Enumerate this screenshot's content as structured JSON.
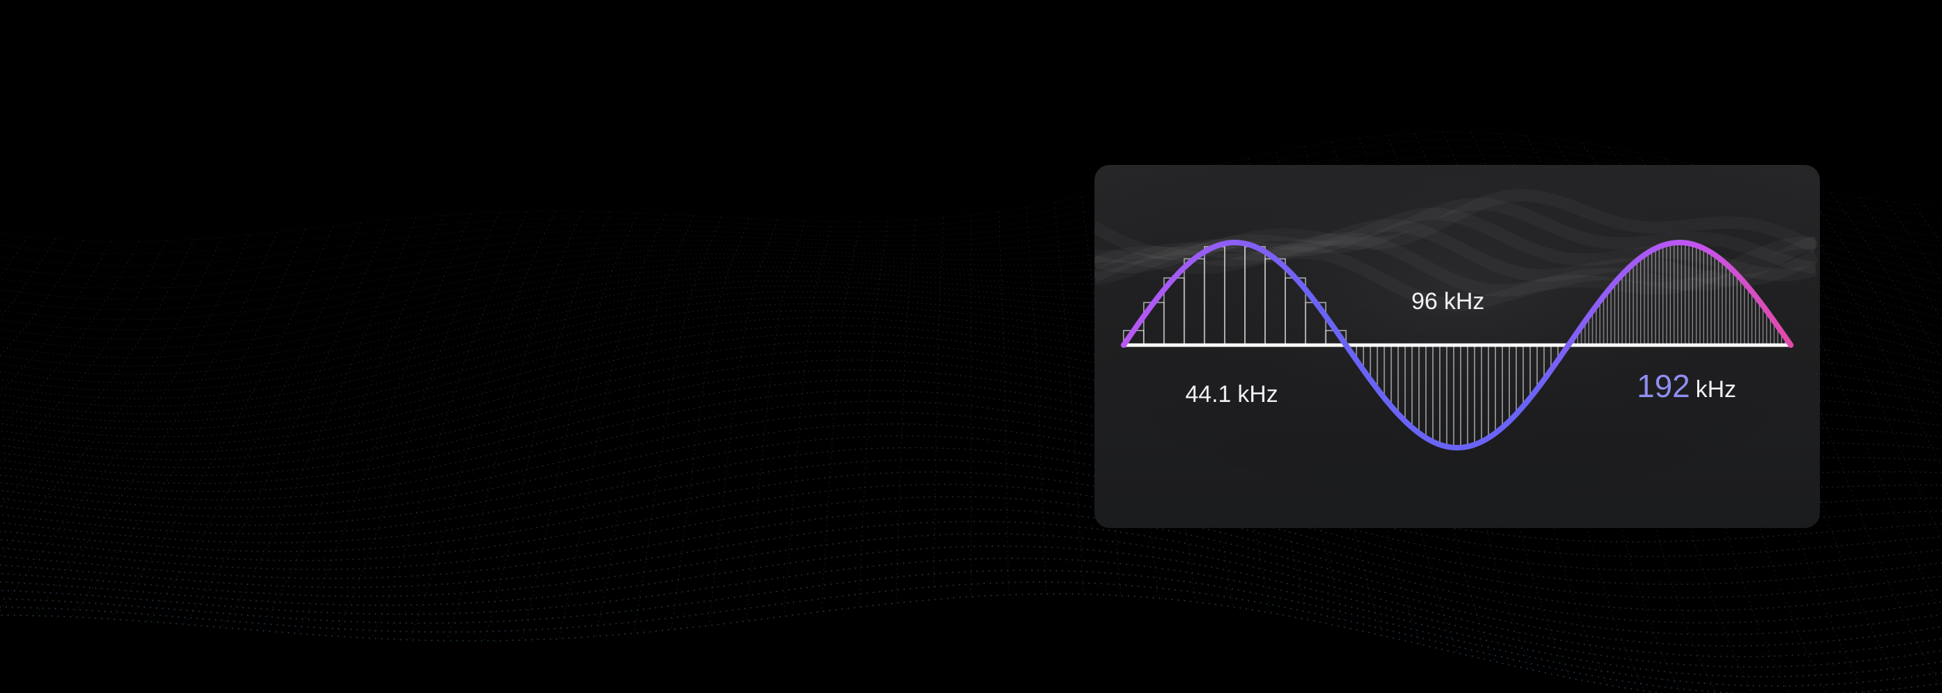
{
  "labels": {
    "low": {
      "value": "44.1",
      "unit": "kHz"
    },
    "mid": {
      "value": "96",
      "unit": "kHz"
    },
    "high": {
      "value": "192",
      "unit": "kHz"
    }
  },
  "colors": {
    "wave_gradient_start": "#c056f2",
    "wave_gradient_mid": "#6a64f6",
    "wave_gradient_end": "#e8489c",
    "baseline": "#ffffff",
    "highlight_value": "#8f8ef2",
    "background_mesh": "#4f7fa6",
    "card_background": "#262628"
  }
}
